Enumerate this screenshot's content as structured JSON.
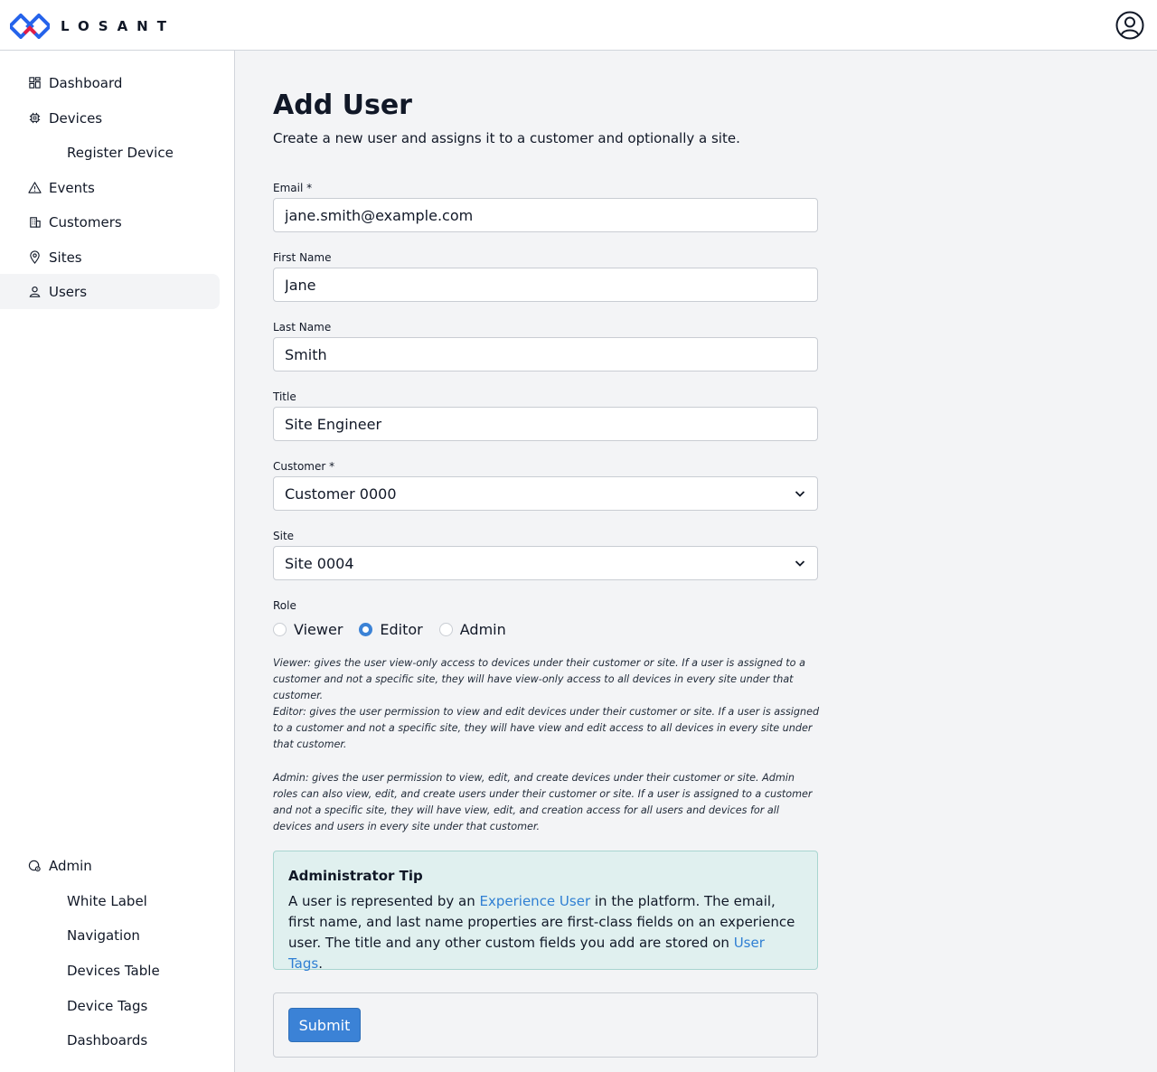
{
  "brand": {
    "name": "LOSANT",
    "colors": {
      "blue": "#2563eb",
      "red": "#e11d48",
      "accent": "#3b82d6"
    }
  },
  "header": {
    "user_icon": "user-circle-icon"
  },
  "sidebar": {
    "items": [
      {
        "label": "Dashboard",
        "icon": "grid-icon"
      },
      {
        "label": "Devices",
        "icon": "chip-icon"
      },
      {
        "label": "Register Device"
      },
      {
        "label": "Events",
        "icon": "warning-icon"
      },
      {
        "label": "Customers",
        "icon": "building-icon"
      },
      {
        "label": "Sites",
        "icon": "map-pin-icon"
      },
      {
        "label": "Users",
        "icon": "user-icon",
        "active": true
      }
    ],
    "admin": {
      "label": "Admin",
      "icon": "admin-gear-icon",
      "items": [
        {
          "label": "White Label"
        },
        {
          "label": "Navigation"
        },
        {
          "label": "Devices Table"
        },
        {
          "label": "Device Tags"
        },
        {
          "label": "Dashboards"
        }
      ]
    }
  },
  "page": {
    "title": "Add User",
    "subtitle": "Create a new user and assigns it to a customer and optionally a site."
  },
  "form": {
    "email": {
      "label": "Email *",
      "value": "jane.smith@example.com"
    },
    "first_name": {
      "label": "First Name",
      "value": "Jane"
    },
    "last_name": {
      "label": "Last Name",
      "value": "Smith"
    },
    "title": {
      "label": "Title",
      "value": "Site Engineer"
    },
    "customer": {
      "label": "Customer *",
      "value": "Customer 0000"
    },
    "site": {
      "label": "Site",
      "value": "Site 0004"
    },
    "role": {
      "label": "Role",
      "options": [
        "Viewer",
        "Editor",
        "Admin"
      ],
      "selected": "Editor"
    },
    "role_descriptions": {
      "viewer": "Viewer: gives the user view-only access to devices under their customer or site. If a user is assigned to a customer and not a specific site, they will have view-only access to all devices in every site under that customer.",
      "editor": "Editor: gives the user permission to view and edit devices under their customer or site. If a user is assigned to a customer and not a specific site, they will have view and edit access to all devices in every site under that customer.",
      "admin": "Admin: gives the user permission to view, edit, and create devices under their customer or site. Admin roles can also view, edit, and create users under their customer or site. If a user is assigned to a customer and not a specific site, they will have view, edit, and creation access for all users and devices for all devices and users in every site under that customer."
    },
    "submit_label": "Submit"
  },
  "tip": {
    "title": "Administrator Tip",
    "text_1": "A user is represented by an ",
    "link_1": "Experience User",
    "text_2": " in the platform. The email, first name, and last name properties are first-class fields on an experience user. The title and any other custom fields you add are stored on ",
    "link_2": "User Tags",
    "text_3": "."
  }
}
